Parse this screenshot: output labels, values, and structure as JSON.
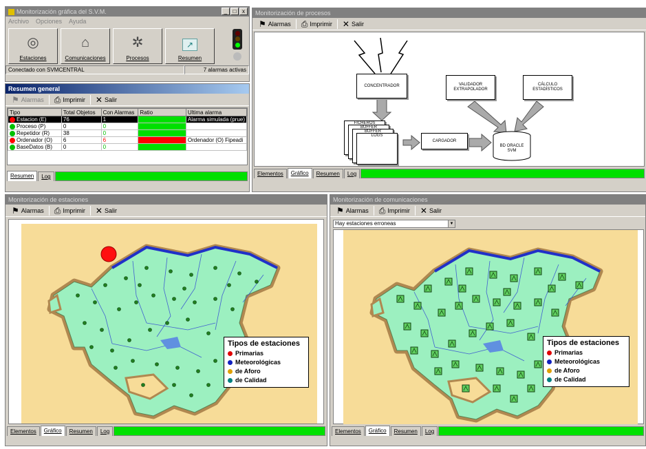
{
  "main_window": {
    "title": "Monitorización gráfica del S.V.M.",
    "title_buttons": [
      "_",
      "□",
      "x"
    ],
    "menu": [
      "Archivo",
      "Opciones",
      "Ayuda"
    ],
    "big_buttons": [
      {
        "label": "Estaciones",
        "icon": "gauge-icon"
      },
      {
        "label": "Comunicaciones",
        "icon": "network-icon"
      },
      {
        "label": "Procesos",
        "icon": "gear-icon"
      },
      {
        "label": "Resumen",
        "icon": "chart-icon"
      }
    ],
    "status_left": "Conectado con SVMCENTRAL",
    "status_right": "7 alarmas activas"
  },
  "summary": {
    "title": "Resumen general",
    "toolbar": {
      "alarms": "Alarmas",
      "print": "Imprimir",
      "exit": "Salir"
    },
    "columns": [
      "Tipo",
      "Total Objetos",
      "Con Alarmas",
      "Ratio",
      "Ultima alarma"
    ],
    "rows": [
      {
        "tipo": "Estacion (E)",
        "total": "76",
        "alarmas": "1",
        "ultima": "Alarma simulada (prue)",
        "icon_color": "#ff0000",
        "ratio_color": "#00e000"
      },
      {
        "tipo": "Proceso (P)",
        "total": "0",
        "alarmas": "0",
        "ultima": "",
        "icon_color": "#00c000",
        "ratio_color": "#00e000"
      },
      {
        "tipo": "Repetidor (R)",
        "total": "38",
        "alarmas": "0",
        "ultima": "",
        "icon_color": "#00c000",
        "ratio_color": "#00e000"
      },
      {
        "tipo": "Ordenador (O)",
        "total": "6",
        "alarmas": "6",
        "ultima": "Ordenador (O) Fipeadi",
        "icon_color": "#ff0000",
        "ratio_color": "#ff0000"
      },
      {
        "tipo": "BaseDatos (B)",
        "total": "0",
        "alarmas": "0",
        "ultima": "",
        "icon_color": "#00c000",
        "ratio_color": "#00e000"
      }
    ],
    "tabs": [
      "Resumen",
      "Log"
    ]
  },
  "processes": {
    "title": "Monitorización de procesos",
    "toolbar": {
      "alarms": "Alarmas",
      "print": "Imprimir",
      "exit": "Salir"
    },
    "diagram": {
      "concentrador": "CONCENTRADOR",
      "validador": "VALIDADOR EXTRAPOLADOR",
      "calculo": "CÁLCULO ESTADÍSTICOS",
      "cargador": "CARGADOR",
      "bd": "BD ORACLE SVM",
      "buffers": [
        "FICHEROS",
        "BUFFER",
        "BUFFER",
        "LOGS"
      ]
    },
    "tabs": [
      "Elementos",
      "Gráfico",
      "Resumen",
      "Log"
    ]
  },
  "stations": {
    "title": "Monitorización de estaciones",
    "toolbar": {
      "alarms": "Alarmas",
      "print": "Imprimir",
      "exit": "Salir"
    },
    "legend": {
      "title": "Tipos de estaciones",
      "items": [
        {
          "label": "Primarias",
          "color": "#e00000"
        },
        {
          "label": "Meteorológicas",
          "color": "#1020c0"
        },
        {
          "label": "de Aforo",
          "color": "#e0a000"
        },
        {
          "label": "de Calidad",
          "color": "#008080"
        }
      ]
    },
    "tabs": [
      "Elementos",
      "Gráfico",
      "Resumen",
      "Log"
    ]
  },
  "communications": {
    "title": "Monitorización de comunicaciones",
    "toolbar": {
      "alarms": "Alarmas",
      "print": "Imprimir",
      "exit": "Salir"
    },
    "combo_value": "Hay estaciones erroneas",
    "legend": {
      "title": "Tipos de estaciones",
      "items": [
        {
          "label": "Primarias",
          "color": "#e00000"
        },
        {
          "label": "Meteorológicas",
          "color": "#1020c0"
        },
        {
          "label": "de Aforo",
          "color": "#e0a000"
        },
        {
          "label": "de Calidad",
          "color": "#008080"
        }
      ]
    },
    "tabs": [
      "Elementos",
      "Gráfico",
      "Resumen",
      "Log"
    ]
  },
  "colors": {
    "map_bg": "#f7dc98",
    "land": "#9cf0c0",
    "coast": "#2030c8",
    "border": "#b08850",
    "tab_fill": "#00e000"
  }
}
